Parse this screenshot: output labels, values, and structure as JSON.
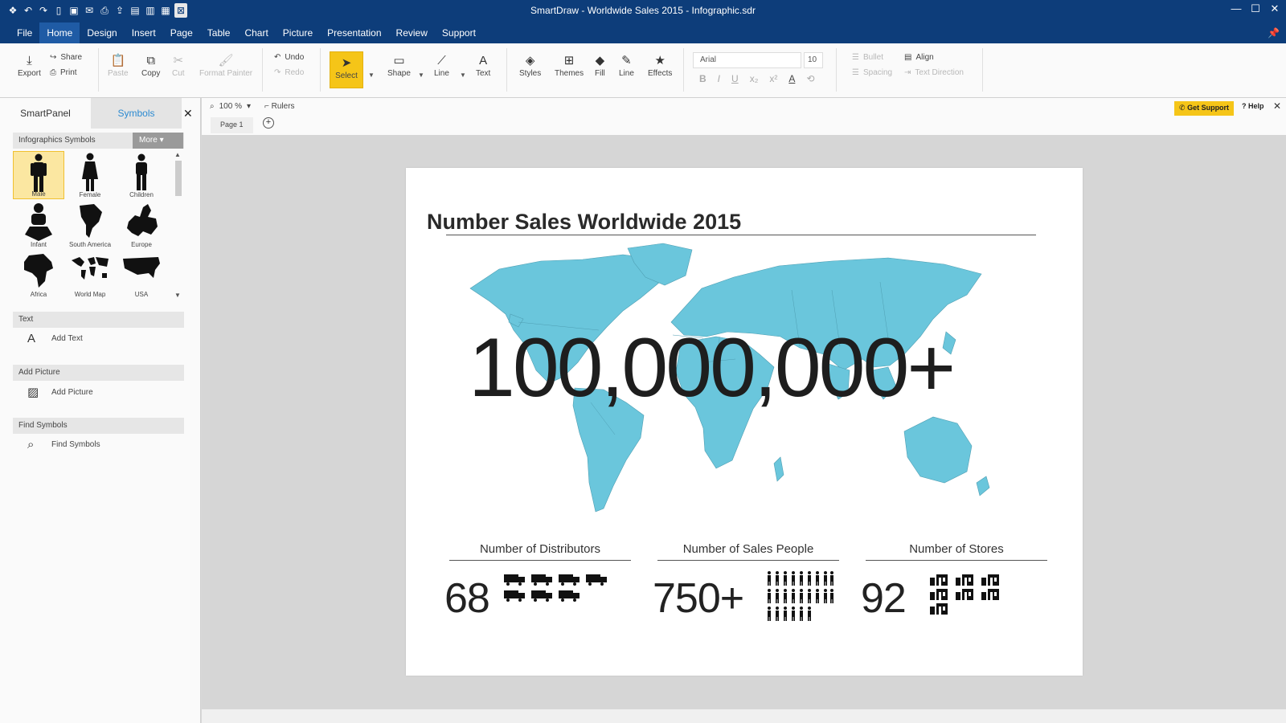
{
  "window": {
    "title": "SmartDraw - Worldwide Sales 2015 - Infographic.sdr",
    "controls": [
      "minimize-icon",
      "maximize-icon",
      "close-icon"
    ]
  },
  "menu": {
    "items": [
      "File",
      "Home",
      "Design",
      "Insert",
      "Page",
      "Table",
      "Chart",
      "Picture",
      "Presentation",
      "Review",
      "Support"
    ],
    "active": "Home"
  },
  "ribbon": {
    "export": "Export",
    "share": "Share",
    "print": "Print",
    "paste": "Paste",
    "copy": "Copy",
    "cut": "Cut",
    "format_painter": "Format Painter",
    "undo": "Undo",
    "redo": "Redo",
    "select": "Select",
    "shape": "Shape",
    "line": "Line",
    "text": "Text",
    "styles": "Styles",
    "themes": "Themes",
    "fill": "Fill",
    "line2": "Line",
    "effects": "Effects",
    "font": "Arial",
    "font_size": "10",
    "bullet": "Bullet",
    "spacing": "Spacing",
    "align": "Align",
    "text_direction": "Text Direction"
  },
  "sidepanel": {
    "tabs": [
      "SmartPanel",
      "Symbols"
    ],
    "active_tab": "Symbols",
    "library": "Infographics Symbols",
    "more": "More",
    "symbols": [
      "Male",
      "Female",
      "Children",
      "Infant",
      "South America",
      "Europe",
      "Africa",
      "World Map",
      "USA"
    ],
    "selected_symbol": "Male",
    "sections": {
      "text": {
        "header": "Text",
        "action": "Add Text"
      },
      "picture": {
        "header": "Add Picture",
        "action": "Add Picture"
      },
      "find": {
        "header": "Find Symbols",
        "action": "Find Symbols"
      }
    }
  },
  "canvas": {
    "zoom": "100 %",
    "rulers": "Rulers",
    "page_tab": "Page 1",
    "get_support": "Get Support",
    "help": "Help"
  },
  "document": {
    "title": "Number Sales Worldwide 2015",
    "big_number": "100,000,000+",
    "map_color": "#6ac6dc",
    "stats": [
      {
        "title": "Number of Distributors",
        "value": "68",
        "icon": "truck-icon",
        "icon_count": 7
      },
      {
        "title": "Number of Sales People",
        "value": "750+",
        "icon": "person-icon",
        "icon_count": 24
      },
      {
        "title": "Number of Stores",
        "value": "92",
        "icon": "store-icon",
        "icon_count": 7
      }
    ]
  }
}
